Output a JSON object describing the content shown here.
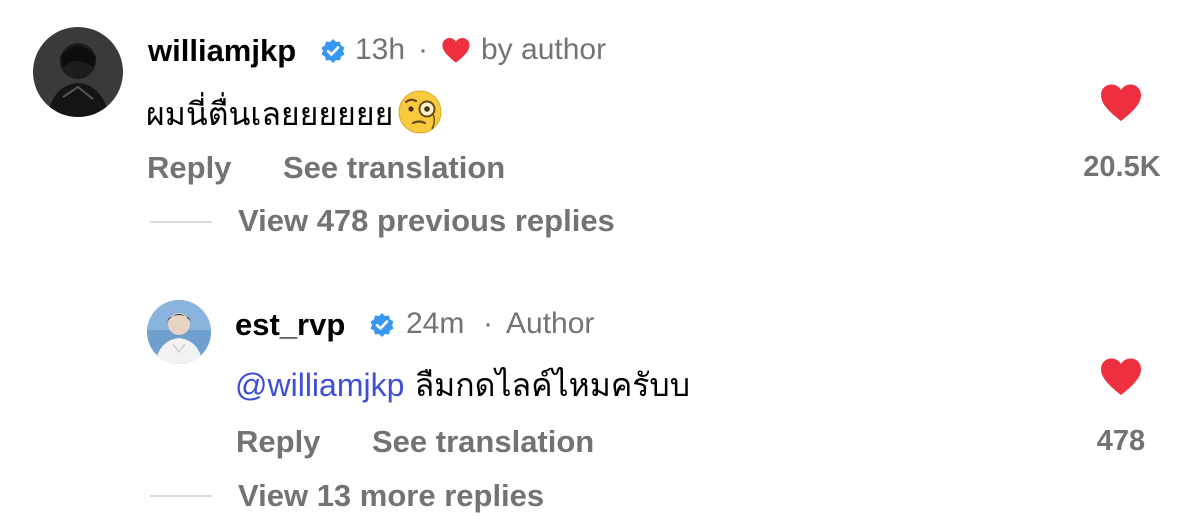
{
  "comment1": {
    "username": "williamjkp",
    "time": "13h",
    "separator": "·",
    "liked_by_author": "by author",
    "text": "ผมนี่ตื่นเลยยยยยย",
    "emoji": "face-with-monocle",
    "reply_label": "Reply",
    "translate_label": "See translation",
    "like_count": "20.5K",
    "view_replies": "View 478 previous replies"
  },
  "comment2": {
    "username": "est_rvp",
    "time": "24m",
    "separator": "·",
    "role": "Author",
    "mention": "@williamjkp",
    "text": "ลืมกดไลค์ไหมครับบ",
    "reply_label": "Reply",
    "translate_label": "See translation",
    "like_count": "478",
    "view_replies": "View 13 more replies"
  },
  "colors": {
    "heart": "#ed2f40",
    "verified": "#3897f0",
    "mention": "#3e4fd6",
    "secondary_text": "#737373"
  }
}
